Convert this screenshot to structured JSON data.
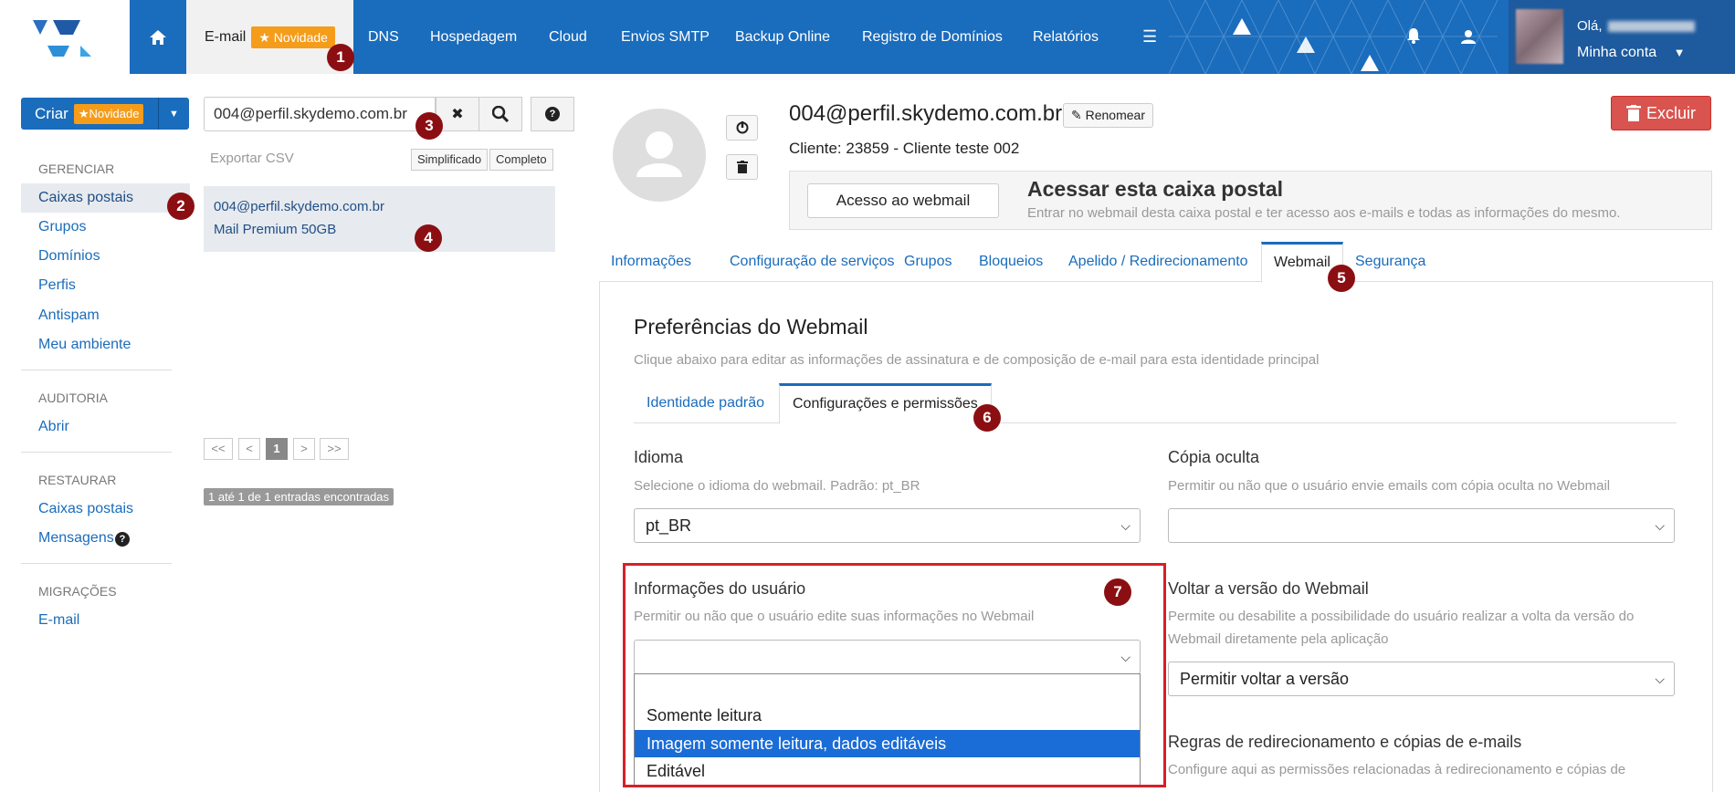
{
  "nav": {
    "items": [
      "DNS",
      "Hospedagem",
      "Cloud",
      "Envios SMTP",
      "Backup Online",
      "Registro de Domínios",
      "Relatórios"
    ],
    "active": "E-mail",
    "active_badge": "Novidade",
    "menu_icon": "hamburger-icon",
    "bell_icon": "bell-icon",
    "user_icon": "user-icon"
  },
  "account": {
    "greeting": "Olá,",
    "label": "Minha conta"
  },
  "sidebar": {
    "create_label": "Criar",
    "create_badge": "Novidade",
    "sections": [
      {
        "title": "GERENCIAR",
        "items": [
          "Caixas postais",
          "Grupos",
          "Domínios",
          "Perfis",
          "Antispam",
          "Meu ambiente"
        ]
      },
      {
        "title": "AUDITORIA",
        "items": [
          "Abrir"
        ]
      },
      {
        "title": "RESTAURAR",
        "items": [
          "Caixas postais",
          "Mensagens"
        ]
      },
      {
        "title": "MIGRAÇÕES",
        "items": [
          "E-mail"
        ]
      }
    ]
  },
  "list": {
    "search_value": "004@perfil.skydemo.com.br",
    "export": "Exportar CSV",
    "view_simple": "Simplificado",
    "view_full": "Completo",
    "result_email": "004@perfil.skydemo.com.br",
    "result_plan": "Mail Premium 50GB",
    "pager": [
      "<<",
      "<",
      "1",
      ">",
      ">>"
    ],
    "count": "1 até 1 de 1 entradas encontradas"
  },
  "mailbox": {
    "title": "004@perfil.skydemo.com.br",
    "rename": "Renomear",
    "client": "Cliente: 23859 - Cliente teste 002",
    "delete": "Excluir",
    "webmail_button": "Acesso ao webmail",
    "webmail_title": "Acessar esta caixa postal",
    "webmail_desc": "Entrar no webmail desta caixa postal e ter acesso aos e-mails e todas as informações do mesmo."
  },
  "tabs": [
    "Informações",
    "Configuração de serviços",
    "Grupos",
    "Bloqueios",
    "Apelido / Redirecionamento",
    "Webmail",
    "Segurança"
  ],
  "active_tab": "Webmail",
  "prefs": {
    "title": "Preferências do Webmail",
    "desc": "Clique abaixo para editar as informações de assinatura e de composição de e-mail para esta identidade principal",
    "subtabs": [
      "Identidade padrão",
      "Configurações e permissões"
    ],
    "idioma_label": "Idioma",
    "idioma_desc": "Selecione o idioma do webmail. Padrão: pt_BR",
    "idioma_value": "pt_BR",
    "copia_label": "Cópia oculta",
    "copia_desc": "Permitir ou não que o usuário envie emails com cópia oculta no Webmail",
    "copia_value": "",
    "info_label": "Informações do usuário",
    "info_desc": "Permitir ou não que o usuário edite suas informações no Webmail",
    "info_value": "",
    "info_options": [
      "Somente leitura",
      "Imagem somente leitura, dados editáveis",
      "Editável"
    ],
    "info_selected": "Imagem somente leitura, dados editáveis",
    "voltar_label": "Voltar a versão do Webmail",
    "voltar_desc1": "Permite ou desabilite a possibilidade do usuário realizar a volta da versão do",
    "voltar_desc2": "Webmail diretamente pela aplicação",
    "voltar_value": "Permitir voltar a versão",
    "regras_label": "Regras de redirecionamento e cópias de e-mails",
    "regras_desc": "Configure aqui as permissões relacionadas à redirecionamento e cópias de"
  },
  "markers": [
    "1",
    "2",
    "3",
    "4",
    "5",
    "6",
    "7"
  ]
}
